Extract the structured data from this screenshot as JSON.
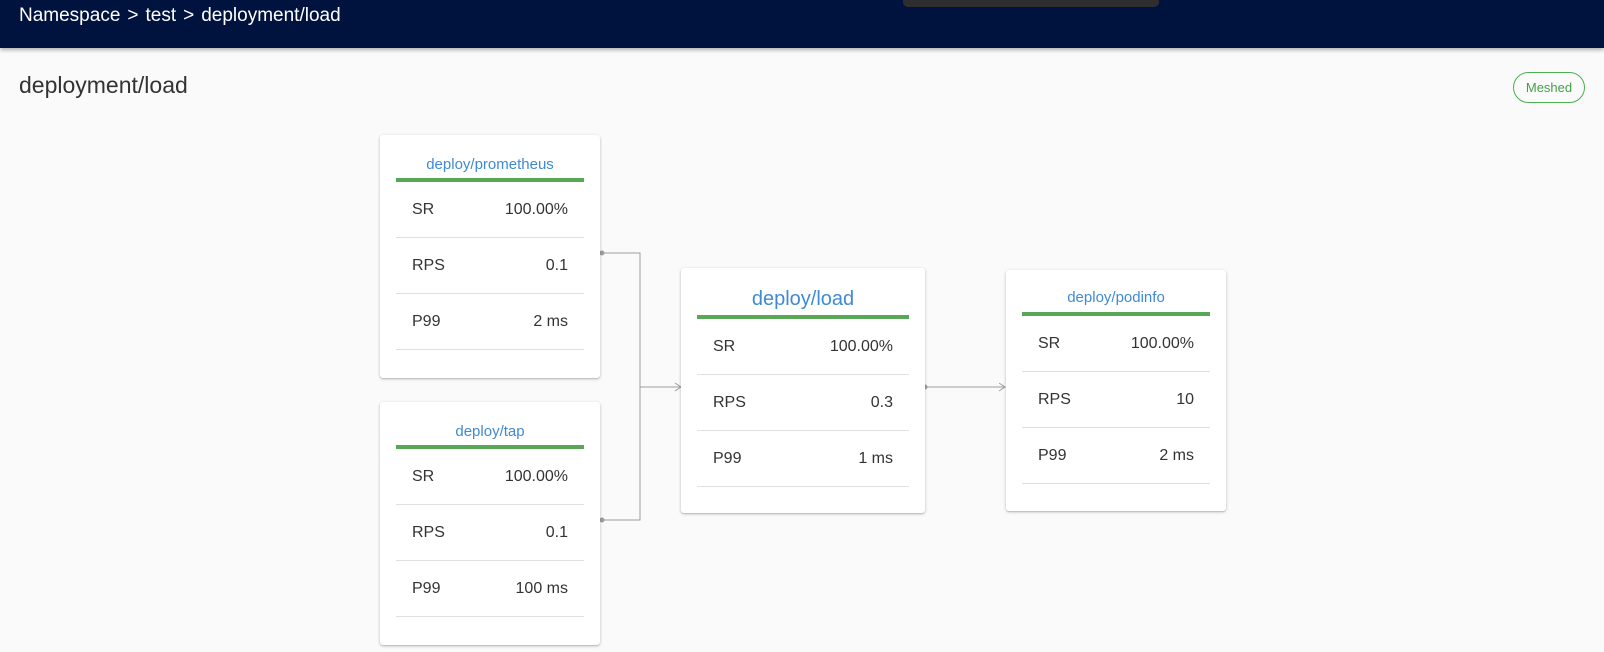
{
  "header": {
    "breadcrumb": [
      "Namespace",
      "test",
      "deployment/load"
    ],
    "separator": ">"
  },
  "page": {
    "title": "deployment/load",
    "status_badge": "Meshed"
  },
  "colors": {
    "appbar": "#00133f",
    "accent_bar": "#58a755",
    "link": "#3f8ad4",
    "badge": "#4caf50"
  },
  "nodes": {
    "prometheus": {
      "name": "deploy/prometheus",
      "metrics": [
        {
          "label": "SR",
          "value": "100.00%"
        },
        {
          "label": "RPS",
          "value": "0.1"
        },
        {
          "label": "P99",
          "value": "2 ms"
        }
      ]
    },
    "tap": {
      "name": "deploy/tap",
      "metrics": [
        {
          "label": "SR",
          "value": "100.00%"
        },
        {
          "label": "RPS",
          "value": "0.1"
        },
        {
          "label": "P99",
          "value": "100 ms"
        }
      ]
    },
    "load": {
      "name": "deploy/load",
      "metrics": [
        {
          "label": "SR",
          "value": "100.00%"
        },
        {
          "label": "RPS",
          "value": "0.3"
        },
        {
          "label": "P99",
          "value": "1 ms"
        }
      ]
    },
    "podinfo": {
      "name": "deploy/podinfo",
      "metrics": [
        {
          "label": "SR",
          "value": "100.00%"
        },
        {
          "label": "RPS",
          "value": "10"
        },
        {
          "label": "P99",
          "value": "2 ms"
        }
      ]
    }
  }
}
